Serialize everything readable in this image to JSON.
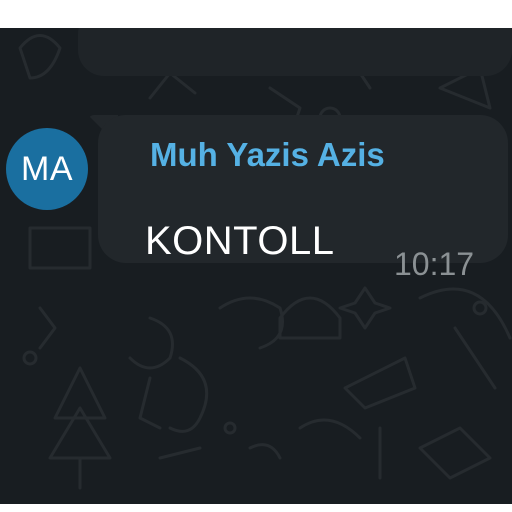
{
  "chat": {
    "background_color": "#181d21",
    "message": {
      "avatar_initials": "MA",
      "avatar_color": "#1a6fa0",
      "sender_name": "Muh Yazis Azis",
      "sender_color": "#55b1e4",
      "text": "KONTOLL",
      "time": "10:17"
    }
  }
}
